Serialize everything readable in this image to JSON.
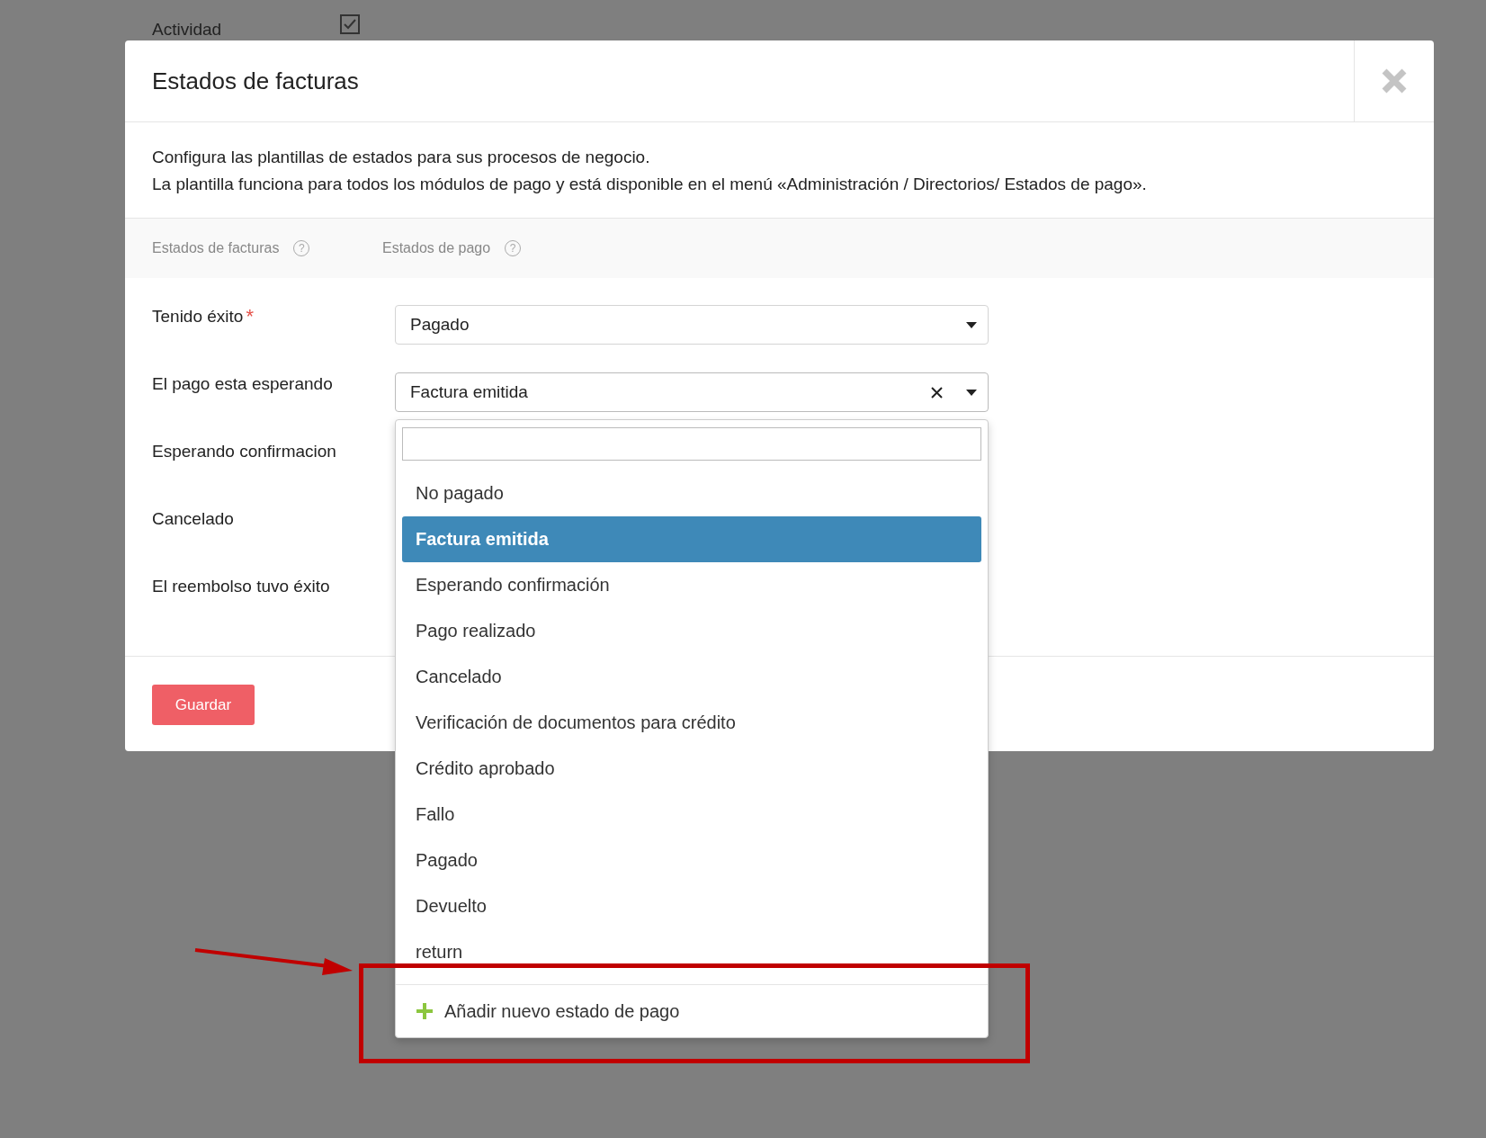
{
  "background": {
    "label": "Actividad",
    "checked": true
  },
  "dialog": {
    "title": "Estados de facturas",
    "description": [
      "Configura las plantillas de estados para sus procesos de negocio.",
      "La plantilla funciona para todos los módulos de pago y está disponible en el menú «Administración / Directorios/ Estados de pago»."
    ],
    "columns": [
      {
        "label": "Estados de facturas",
        "help": "?"
      },
      {
        "label": "Estados de pago",
        "help": "?"
      }
    ],
    "rows": [
      {
        "label": "Tenido éxito",
        "required_mark": "*",
        "value": "Pagado",
        "open": false
      },
      {
        "label": "El pago esta esperando",
        "value": "Factura emitida",
        "clearable": true,
        "open": true
      },
      {
        "label": "Esperando confirmacion"
      },
      {
        "label": "Cancelado"
      },
      {
        "label": "El reembolso tuvo éxito"
      }
    ],
    "save_button": "Guardar"
  },
  "dropdown": {
    "options": [
      {
        "label": "No pagado",
        "selected": false
      },
      {
        "label": "Factura emitida",
        "selected": true
      },
      {
        "label": "Esperando confirmación",
        "selected": false
      },
      {
        "label": "Pago realizado",
        "selected": false
      },
      {
        "label": "Cancelado",
        "selected": false
      },
      {
        "label": "Verificación de documentos para crédito",
        "selected": false
      },
      {
        "label": "Crédito aprobado",
        "selected": false
      },
      {
        "label": "Fallo",
        "selected": false
      },
      {
        "label": "Pagado",
        "selected": false
      },
      {
        "label": "Devuelto",
        "selected": false
      },
      {
        "label": "return",
        "selected": false
      }
    ],
    "add_action": "Añadir nuevo estado de pago"
  },
  "annotations": {
    "arrow": true,
    "frame": true
  }
}
